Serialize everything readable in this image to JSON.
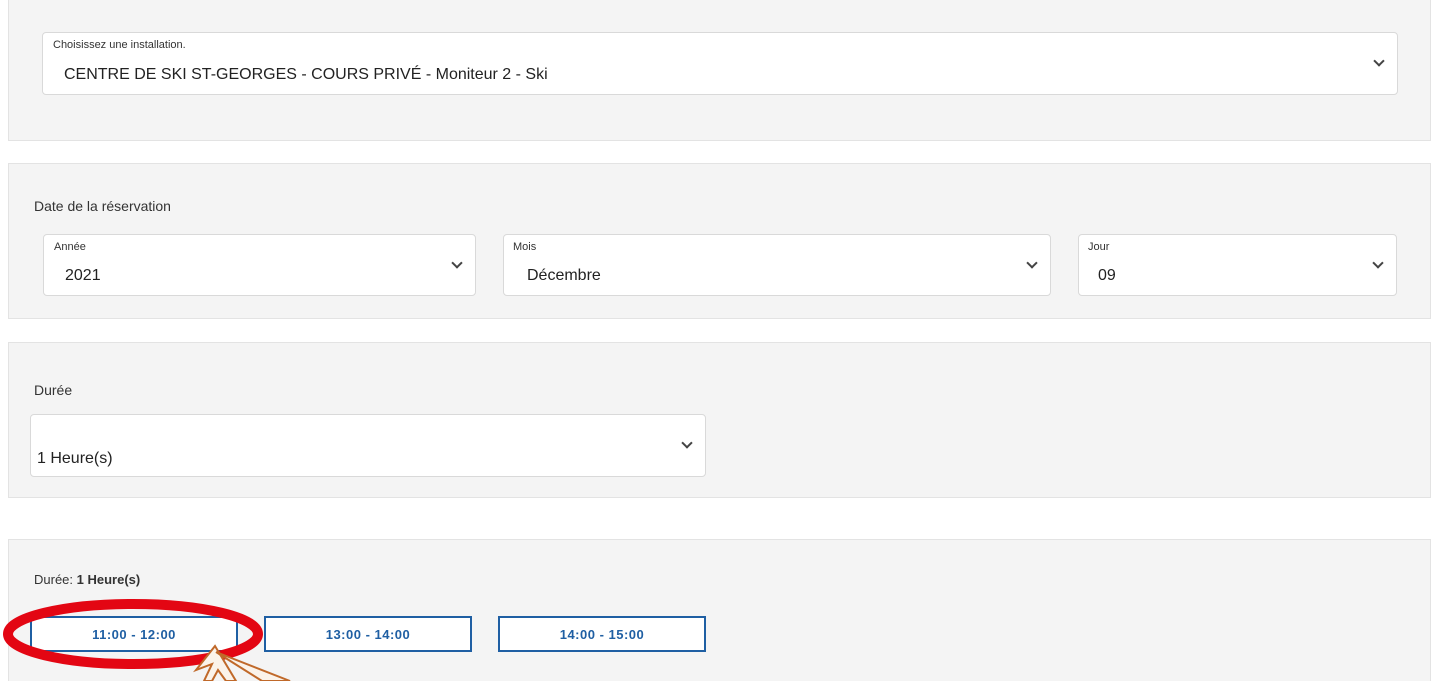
{
  "installation": {
    "label": "Choisissez une installation.",
    "value": "CENTRE DE SKI ST-GEORGES - COURS PRIVÉ - Moniteur 2 - Ski"
  },
  "date": {
    "section_label": "Date de la réservation",
    "year": {
      "label": "Année",
      "value": "2021"
    },
    "month": {
      "label": "Mois",
      "value": "Décembre"
    },
    "day": {
      "label": "Jour",
      "value": "09"
    }
  },
  "duration": {
    "section_label": "Durée",
    "value": "1 Heure(s)"
  },
  "slots": {
    "summary_prefix": "Durée: ",
    "summary_value": "1 Heure(s)",
    "items": [
      "11:00 - 12:00",
      "13:00 - 14:00",
      "14:00 - 15:00"
    ]
  },
  "annotation": {
    "highlight_color": "#e30613",
    "arrow_color": "#c0692a",
    "arrow_fill": "#fbf3ea"
  }
}
